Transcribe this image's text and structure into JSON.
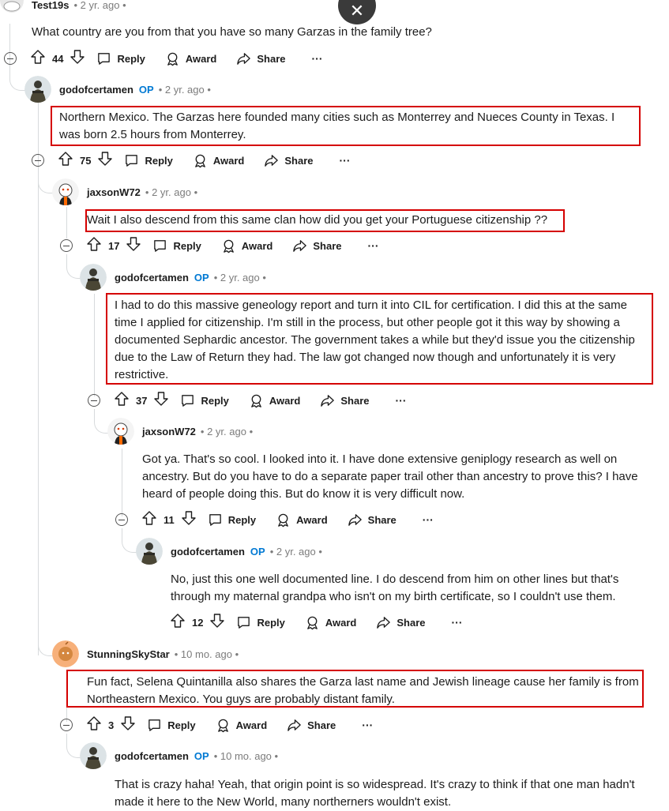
{
  "close_button": {
    "label": "✕"
  },
  "actions": {
    "reply": "Reply",
    "award": "Award",
    "share": "Share",
    "more": "···"
  },
  "op_label": "OP",
  "comments": [
    {
      "author": "Test19s",
      "time": "• 2 yr. ago •",
      "body": "What country are you from that you have so many Garzas in the family tree?",
      "score": "44"
    },
    {
      "author": "godofcertamen",
      "time": "• 2 yr. ago •",
      "body": "Northern Mexico. The Garzas here founded many cities such as Monterrey and Nueces County in Texas. I was born 2.5 hours from Monterrey.",
      "score": "75"
    },
    {
      "author": "jaxsonW72",
      "time": "• 2 yr. ago •",
      "body": "Wait I also descend from this same clan how did you get your Portuguese citizenship ??",
      "score": "17"
    },
    {
      "author": "godofcertamen",
      "time": "• 2 yr. ago •",
      "body": "I had to do this massive geneology report and turn it into CIL for certification. I did this at the same time I applied for citizenship. I'm still in the process, but other people got it this way by showing a documented Sephardic ancestor. The government takes a while but they'd issue you the citizenship due to the Law of Return they had. The law got changed now though and unfortunately it is very restrictive.",
      "score": "37"
    },
    {
      "author": "jaxsonW72",
      "time": "• 2 yr. ago •",
      "body": "Got ya. That's so cool. I looked into it. I have done extensive geniplogy research as well on ancestry. But do you have to do a separate paper trail other than ancestry to prove this? I have heard of people doing this. But do know it is very difficult now.",
      "score": "11"
    },
    {
      "author": "godofcertamen",
      "time": "• 2 yr. ago •",
      "body": "No, just this one well documented line. I do descend from him on other lines but that's through my maternal grandpa who isn't on my birth certificate, so I couldn't use them.",
      "score": "12"
    },
    {
      "author": "StunningSkyStar",
      "time": "• 10 mo. ago •",
      "body": "Fun fact, Selena Quintanilla also shares the Garza last name and Jewish lineage cause her family is from Northeastern Mexico. You guys are probably distant family.",
      "score": "3"
    },
    {
      "author": "godofcertamen",
      "time": "• 10 mo. ago •",
      "body": "That is crazy haha! Yeah, that origin point is so widespread. It's crazy to think if that one man hadn't made it here to the New World, many northerners wouldn't exist."
    }
  ]
}
